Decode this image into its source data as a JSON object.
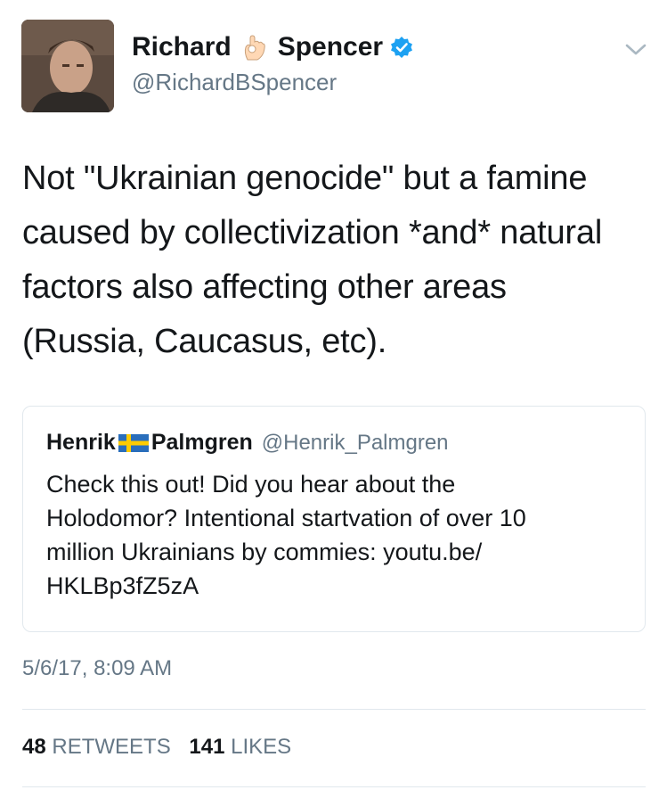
{
  "author": {
    "first_name": "Richard",
    "last_name": "Spencer",
    "handle": "@RichardBSpencer",
    "verified_color": "#1da1f2"
  },
  "tweet": {
    "lines": [
      "Not \"Ukrainian genocide\" but a famine",
      "caused by collectivization *and* natural",
      "factors also affecting other areas",
      "(Russia, Caucasus, etc)."
    ]
  },
  "quoted": {
    "first_name": "Henrik",
    "last_name": "Palmgren",
    "handle": "@Henrik_Palmgren",
    "lines": [
      "Check this out!  Did you hear about the",
      "Holodomor? Intentional startvation of over 10",
      "million Ukrainians by commies: youtu.be/",
      "HKLBp3fZ5zA"
    ]
  },
  "timestamp": "5/6/17, 8:09 AM",
  "stats": {
    "retweets_count": "48",
    "retweets_label": "RETWEETS",
    "likes_count": "141",
    "likes_label": "LIKES"
  },
  "icons": {
    "ok_hand": "ok-hand-emoji-icon",
    "verified": "verified-badge-icon",
    "chevron": "chevron-down-icon",
    "flag": "sweden-flag-icon"
  }
}
